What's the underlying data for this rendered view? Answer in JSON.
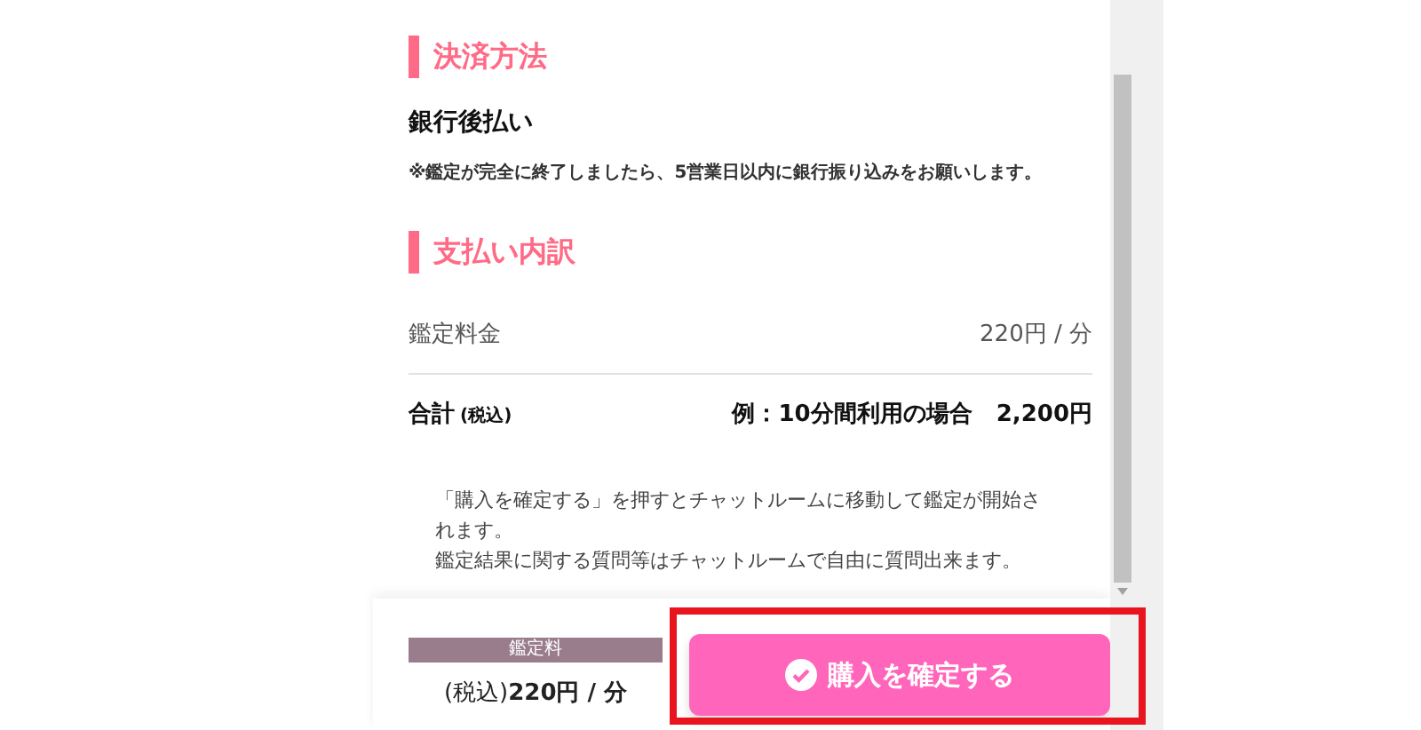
{
  "payment_method": {
    "heading": "決済方法",
    "method": "銀行後払い",
    "note": "※鑑定が完全に終了しましたら、5営業日以内に銀行振り込みをお願いします。"
  },
  "breakdown": {
    "heading": "支払い内訳",
    "rows": [
      {
        "kind": "fee",
        "label": "鑑定料金",
        "value": "220円 / 分"
      },
      {
        "kind": "total",
        "label": "合計",
        "label_suffix": "(税込)",
        "example": "例：10分間利用の場合",
        "value": "2,200円"
      }
    ]
  },
  "notice": [
    "「購入を確定する」を押すとチャットルームに移動して鑑定が開始されます。",
    "鑑定結果に関する質問等はチャットルームで自由に質問出来ます。"
  ],
  "footer": {
    "price_label": "鑑定料",
    "price_prefix": "(税込)",
    "price": "220円 / 分",
    "confirm_button": "購入を確定する",
    "highlighted": true
  }
}
